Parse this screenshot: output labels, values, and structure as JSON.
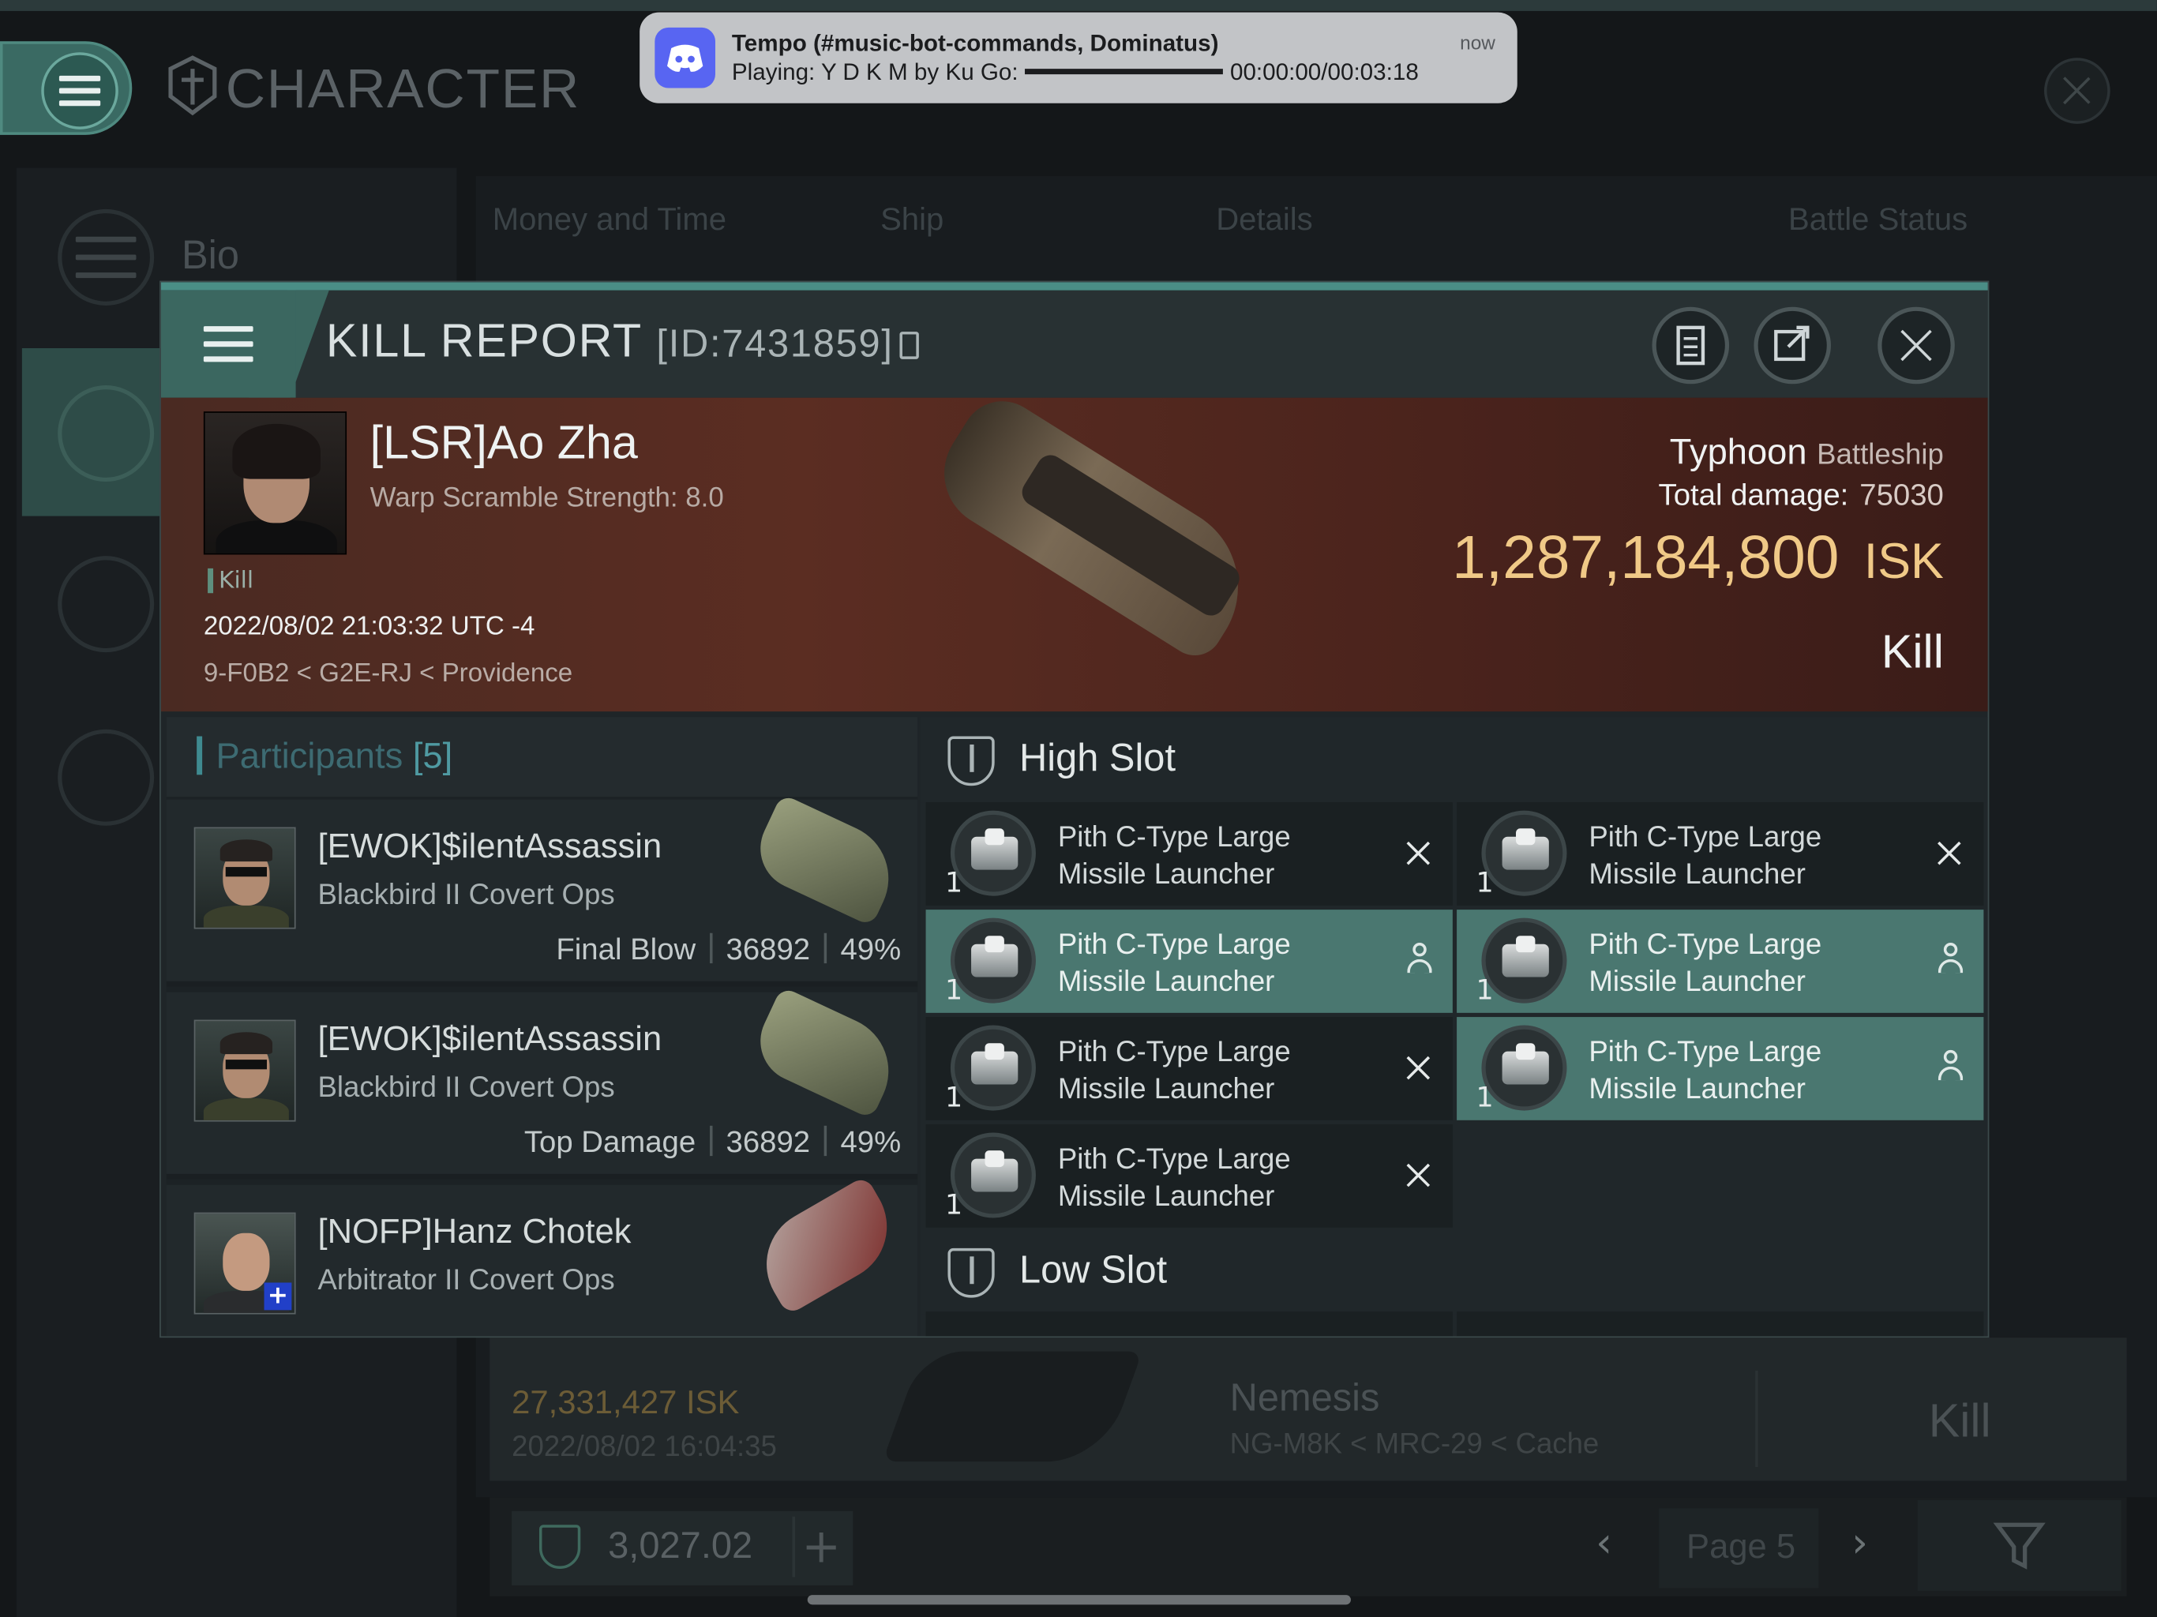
{
  "app": {
    "title": "CHARACTER",
    "menu_icon": "hamburger-icon",
    "close_icon": "close-icon"
  },
  "notification": {
    "app_icon": "discord-icon",
    "title": "Tempo (#music-bot-commands, Dominatus)",
    "playing_prefix": "Playing: Y D K M by Ku Go:",
    "progress": 0.0,
    "time": "00:00:00/00:03:18",
    "age": "now"
  },
  "sidebar": {
    "items": [
      {
        "label": "Bio",
        "icon": "hamburger-icon"
      },
      {
        "label": "",
        "icon": "crossed-swords-icon"
      },
      {
        "label": "",
        "icon": "star-icon"
      },
      {
        "label": "",
        "icon": "star-circle-icon"
      }
    ]
  },
  "background_tabs": [
    "Money and Time",
    "Ship",
    "Details",
    "Battle Status"
  ],
  "background_row": {
    "isk": "27,331,427 ISK",
    "date": "2022/08/02 16:04:35",
    "ship": "Nemesis",
    "location": "NG-M8K < MRC-29 < Cache",
    "result": "Kill"
  },
  "bottom": {
    "wallet": "3,027.02",
    "page": "Page 5"
  },
  "kill_report": {
    "title": "KILL REPORT",
    "id": "[ID:7431859]",
    "victim": {
      "name": "[LSR]Ao Zha",
      "warp_scramble": "Warp Scramble Strength: 8.0",
      "tag": "Kill",
      "date": "2022/08/02 21:03:32 UTC -4",
      "location": "9-F0B2 < G2E-RJ < Providence"
    },
    "ship": {
      "name": "Typhoon",
      "class": "Battleship",
      "total_damage_label": "Total damage:",
      "total_damage": "75030",
      "isk_value": "1,287,184,800",
      "isk_unit": "ISK",
      "result": "Kill"
    },
    "participants": {
      "label": "Participants",
      "count": "[5]",
      "rows": [
        {
          "name": "[EWOK]$ilentAssassin",
          "ship": "Blackbird II Covert Ops",
          "role": "Final Blow",
          "damage": "36892",
          "percent": "49%"
        },
        {
          "name": "[EWOK]$ilentAssassin",
          "ship": "Blackbird II Covert Ops",
          "role": "Top Damage",
          "damage": "36892",
          "percent": "49%"
        },
        {
          "name": "[NOFP]Hanz Chotek",
          "ship": "Arbitrator II Covert Ops",
          "role": "",
          "damage": "",
          "percent": ""
        }
      ]
    },
    "high_slot": {
      "label": "High Slot",
      "modules": [
        {
          "line1": "Pith C-Type Large",
          "line2": "Missile Launcher",
          "qty": "1",
          "state": "destroyed"
        },
        {
          "line1": "Pith C-Type Large",
          "line2": "Missile Launcher",
          "qty": "1",
          "state": "destroyed"
        },
        {
          "line1": "Pith C-Type Large",
          "line2": "Missile Launcher",
          "qty": "1",
          "state": "dropped"
        },
        {
          "line1": "Pith C-Type Large",
          "line2": "Missile Launcher",
          "qty": "1",
          "state": "dropped"
        },
        {
          "line1": "Pith C-Type Large",
          "line2": "Missile Launcher",
          "qty": "1",
          "state": "destroyed"
        },
        {
          "line1": "Pith C-Type Large",
          "line2": "Missile Launcher",
          "qty": "1",
          "state": "dropped"
        },
        {
          "line1": "Pith C-Type Large",
          "line2": "Missile Launcher",
          "qty": "1",
          "state": "destroyed"
        }
      ]
    },
    "low_slot": {
      "label": "Low Slot"
    }
  }
}
